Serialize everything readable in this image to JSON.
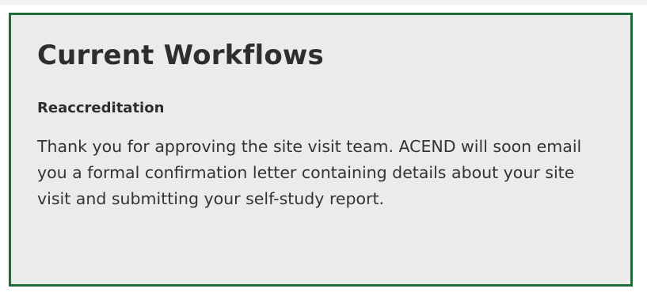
{
  "panel": {
    "title": "Current Workflows",
    "border_color": "#1f6b3a",
    "background_color": "#ebebeb",
    "workflow": {
      "name": "Reaccreditation",
      "description": "Thank you for approving the site visit team. ACEND will soon email you a formal confirmation letter containing details about your site visit and submitting your self-study report."
    }
  }
}
